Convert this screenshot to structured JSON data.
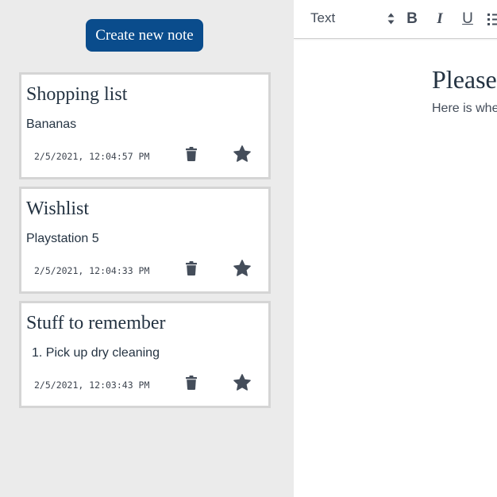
{
  "sidebar": {
    "create_button_label": "Create new note",
    "notes": [
      {
        "title": "Shopping list",
        "preview": "Bananas",
        "timestamp": "2/5/2021, 12:04:57 PM",
        "delete_icon": "trash-icon",
        "favorite_icon": "star-icon"
      },
      {
        "title": "Wishlist",
        "preview": "Playstation 5",
        "timestamp": "2/5/2021, 12:04:33 PM",
        "delete_icon": "trash-icon",
        "favorite_icon": "star-icon"
      },
      {
        "title": "Stuff to remember",
        "preview": "1. Pick up dry cleaning",
        "timestamp": "2/5/2021, 12:03:43 PM",
        "delete_icon": "trash-icon",
        "favorite_icon": "star-icon"
      }
    ]
  },
  "editor": {
    "toolbar": {
      "format_value": "Text",
      "bold_label": "B",
      "italic_label": "I",
      "underline_label": "U"
    },
    "title": "Please",
    "subtitle": "Here is whe"
  },
  "colors": {
    "sidebar_bg": "#ebebeb",
    "accent": "#0a4c8c",
    "text": "#243342",
    "icon": "#444d5a"
  }
}
